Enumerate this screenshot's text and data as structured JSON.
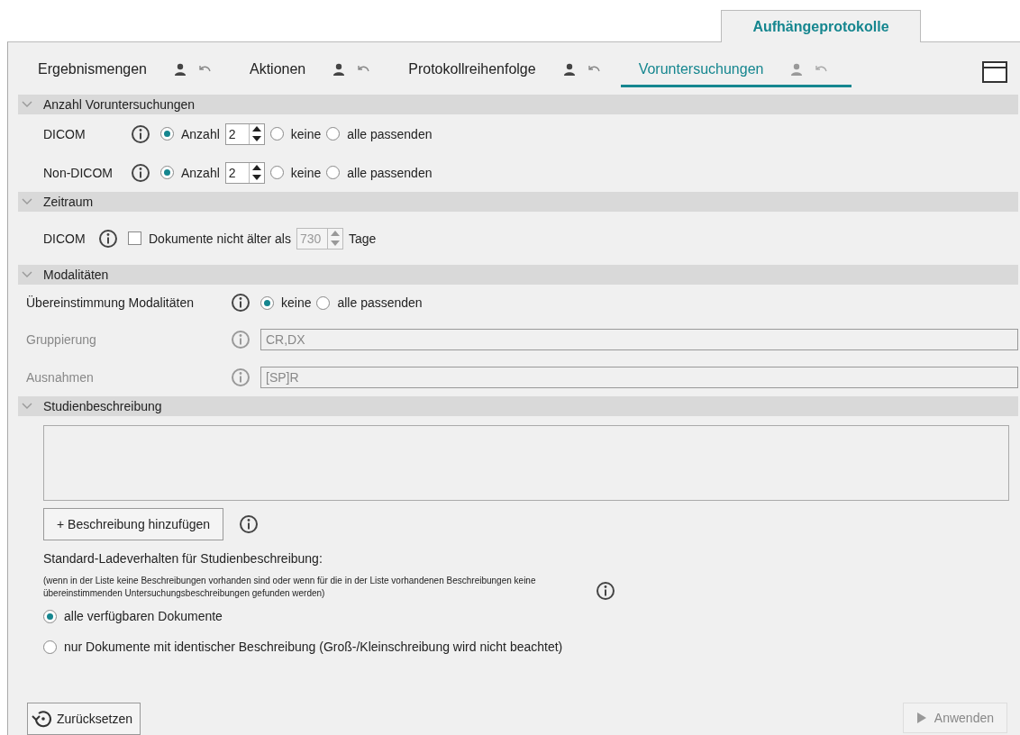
{
  "top_tab": {
    "label": "Aufhängeprotokolle",
    "selected": true
  },
  "tabs": [
    {
      "label": "Ergebnismengen",
      "selected": false
    },
    {
      "label": "Aktionen",
      "selected": false
    },
    {
      "label": "Protokollreihenfolge",
      "selected": false
    },
    {
      "label": "Voruntersuchungen",
      "selected": true
    }
  ],
  "sections": [
    {
      "kind": "counts",
      "title": "Anzahl Voruntersuchungen",
      "expanded": true,
      "rows": [
        {
          "label": "DICOM",
          "options": [
            {
              "label": "Anzahl",
              "selected": true,
              "spin": "2"
            },
            {
              "label": "keine",
              "selected": false
            },
            {
              "label": "alle passenden",
              "selected": false
            }
          ]
        },
        {
          "label": "Non-DICOM",
          "options": [
            {
              "label": "Anzahl",
              "selected": true,
              "spin": "2"
            },
            {
              "label": "keine",
              "selected": false
            },
            {
              "label": "alle passenden",
              "selected": false
            }
          ]
        }
      ]
    },
    {
      "kind": "period",
      "title": "Zeitraum",
      "expanded": true,
      "rows": [
        {
          "label": "DICOM",
          "checkbox": {
            "label": "Dokumente nicht älter als",
            "checked": false
          },
          "spin": {
            "value": "730",
            "disabled": true
          },
          "unit": "Tage"
        }
      ]
    },
    {
      "kind": "modalities",
      "title": "Modalitäten",
      "expanded": true,
      "match": {
        "label": "Übereinstimmung Modalitäten",
        "options": [
          {
            "label": "keine",
            "selected": true
          },
          {
            "label": "alle passenden",
            "selected": false
          }
        ]
      },
      "fields": [
        {
          "label": "Gruppierung",
          "value": "CR,DX",
          "disabled": true
        },
        {
          "label": "Ausnahmen",
          "value": "[SP]R",
          "disabled": true
        }
      ]
    },
    {
      "kind": "description",
      "title": "Studienbeschreibung",
      "expanded": true,
      "add_button": "+ Beschreibung hinzufügen",
      "heading": "Standard-Ladeverhalten für Studienbeschreibung:",
      "note": "(wenn in der Liste keine Beschreibungen vorhanden sind oder wenn für die in der Liste vorhandenen Beschreibungen keine übereinstimmenden Untersuchungsbeschreibungen gefunden werden)",
      "options": [
        {
          "label": "alle verfügbaren Dokumente",
          "selected": true
        },
        {
          "label": "nur Dokumente mit identischer Beschreibung (Groß-/Kleinschreibung wird nicht beachtet)",
          "selected": false
        }
      ]
    }
  ],
  "footer": {
    "reset_button": "Zurücksetzen",
    "apply_button": {
      "label": "Anwenden",
      "disabled": true
    }
  }
}
